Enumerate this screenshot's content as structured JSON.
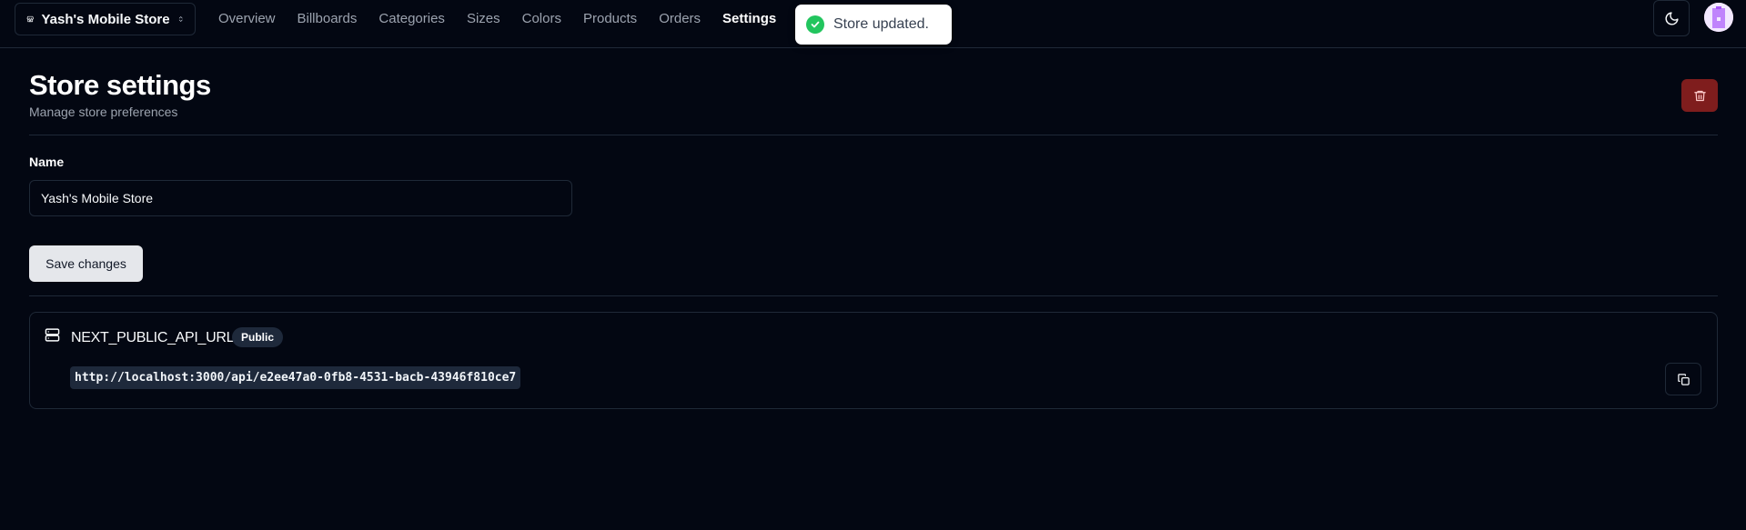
{
  "header": {
    "store_name": "Yash's Mobile Store",
    "nav": [
      {
        "label": "Overview",
        "active": false
      },
      {
        "label": "Billboards",
        "active": false
      },
      {
        "label": "Categories",
        "active": false
      },
      {
        "label": "Sizes",
        "active": false
      },
      {
        "label": "Colors",
        "active": false
      },
      {
        "label": "Products",
        "active": false
      },
      {
        "label": "Orders",
        "active": false
      },
      {
        "label": "Settings",
        "active": true
      }
    ]
  },
  "toast": {
    "message": "Store updated."
  },
  "page": {
    "title": "Store settings",
    "subtitle": "Manage store preferences"
  },
  "form": {
    "name_label": "Name",
    "name_value": "Yash's Mobile Store",
    "save_label": "Save changes"
  },
  "api": {
    "title": "NEXT_PUBLIC_API_URL",
    "badge": "Public",
    "url": "http://localhost:3000/api/e2ee47a0-0fb8-4531-bacb-43946f810ce7"
  },
  "colors": {
    "background": "#030712",
    "border": "#1f2937",
    "danger": "#7f1d1d",
    "success": "#22c55e",
    "muted_text": "#9ca3af"
  },
  "icons": {
    "store_switcher": "store-icon",
    "switcher_chevron": "chevrons-up-down-icon",
    "toast": "check-circle-icon",
    "theme": "moon-icon",
    "delete": "trash-icon",
    "api": "server-icon",
    "copy": "copy-icon"
  }
}
